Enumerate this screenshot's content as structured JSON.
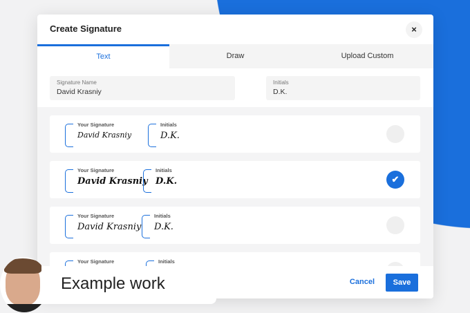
{
  "modal": {
    "title": "Create Signature",
    "close_icon": "×"
  },
  "tabs": [
    {
      "label": "Text"
    },
    {
      "label": "Draw"
    },
    {
      "label": "Upload Custom"
    }
  ],
  "fields": {
    "name_label": "Signature Name",
    "name_value": "David Krasniy",
    "initials_label": "Initials",
    "initials_value": "D.K."
  },
  "options": [
    {
      "sig_label": "Your Signature",
      "sig": "David Krasniy",
      "init_label": "Initials",
      "init": "D.K.",
      "selected": false
    },
    {
      "sig_label": "Your Signature",
      "sig": "David Krasniy",
      "init_label": "Initials",
      "init": "D.K.",
      "selected": true,
      "check": "✔"
    },
    {
      "sig_label": "Your Signature",
      "sig": "David Krasniy",
      "init_label": "Initials",
      "init": "D.K.",
      "selected": false
    },
    {
      "sig_label": "Your Signature",
      "init_label": "Initials",
      "selected": false
    }
  ],
  "footer": {
    "cancel": "Cancel",
    "save": "Save"
  },
  "overlay": {
    "label": "Example work"
  },
  "colors": {
    "accent": "#1a6fdc"
  }
}
